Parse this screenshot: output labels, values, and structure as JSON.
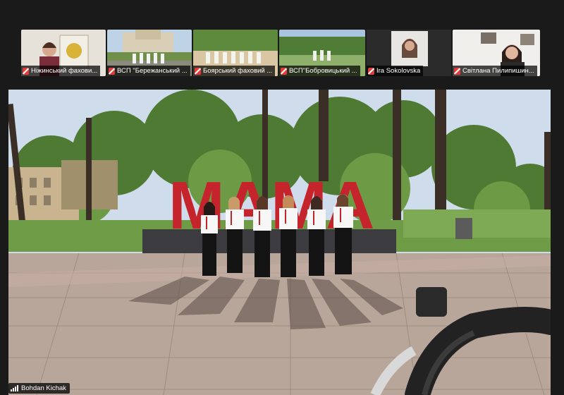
{
  "participants": [
    {
      "name": "Ніжинський фахови..."
    },
    {
      "name": "ВСП \"Бережанський ..."
    },
    {
      "name": "Боярський фаховий ..."
    },
    {
      "name": "ВСП\"Бобровицький ..."
    },
    {
      "name": "Ira Sokolovska"
    },
    {
      "name": "Світлана Пилипишин..."
    }
  ],
  "main_video": {
    "sign_text": "MAMA",
    "active_speaker": "Bohdan Kichak"
  },
  "colors": {
    "mute_icon": "#e23b3b",
    "sign": "#c6242c",
    "background": "#1a1a1a"
  }
}
